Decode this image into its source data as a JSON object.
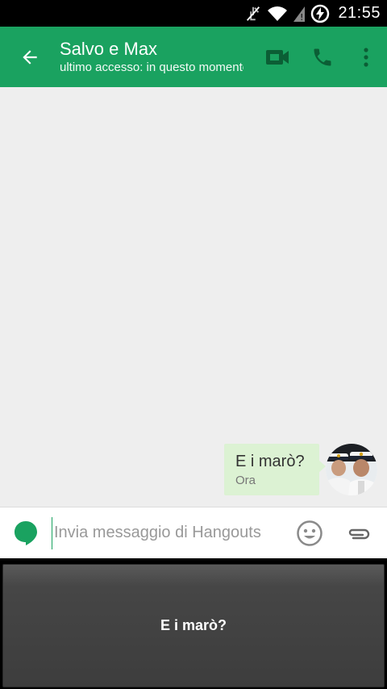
{
  "status_bar": {
    "time": "21:55",
    "icons": [
      "mute-icon",
      "wifi-icon",
      "signal-icon",
      "battery-charging-icon"
    ]
  },
  "app_bar": {
    "back_icon": "arrow-back-icon",
    "title": "Salvo e Max",
    "subtitle": "ultimo accesso: in questo momento",
    "actions": [
      "video-call-icon",
      "phone-icon",
      "more-vert-icon"
    ],
    "color": "#1aa260"
  },
  "conversation": {
    "background": "#eeeeee",
    "messages": [
      {
        "text": "E i marò?",
        "time": "Ora",
        "direction": "outgoing",
        "bubble_color": "#dcf2d3"
      }
    ]
  },
  "compose": {
    "placeholder": "Invia messaggio di Hangouts",
    "value": "",
    "icons": [
      "hangouts-icon",
      "emoji-icon",
      "attach-icon"
    ]
  },
  "keyboard_suggestion": {
    "text": "E i marò?"
  }
}
